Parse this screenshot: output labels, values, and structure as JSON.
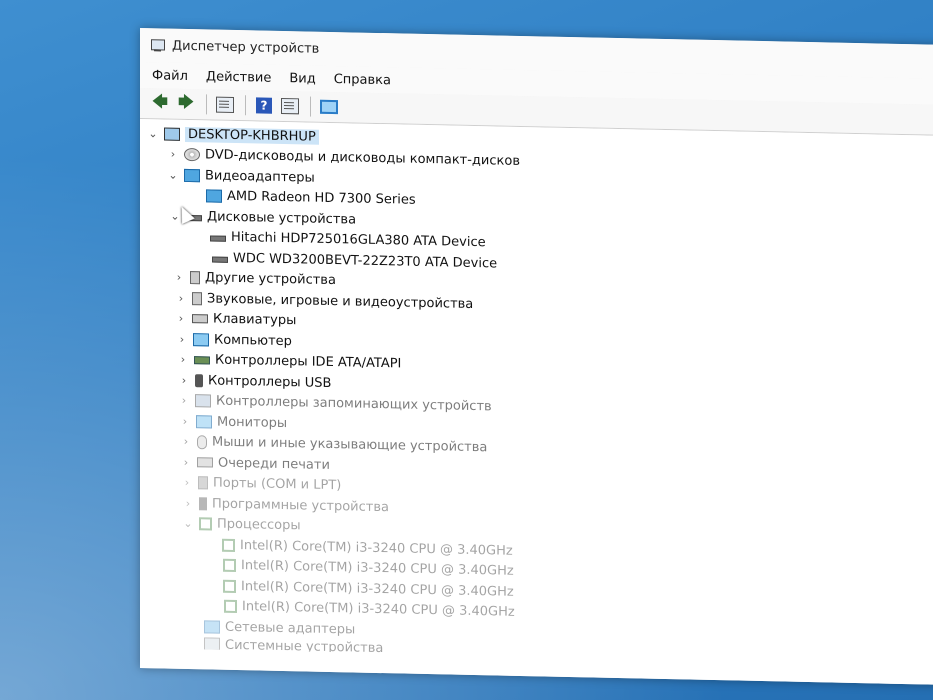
{
  "window": {
    "title": "Диспетчер устройств",
    "controls": {
      "minimize": "—"
    }
  },
  "menubar": [
    "Файл",
    "Действие",
    "Вид",
    "Справка"
  ],
  "toolbar": {
    "back": "🡄",
    "forward": "🡆",
    "help": "?"
  },
  "tree": {
    "root": "DESKTOP-KHBRHUP",
    "items": [
      {
        "label": "DVD-дисководы и дисководы компакт-дисков",
        "expanded": false
      },
      {
        "label": "Видеоадаптеры",
        "expanded": true
      },
      {
        "label": "AMD Radeon HD 7300 Series",
        "child": true
      },
      {
        "label": "Дисковые устройства",
        "expanded": true
      },
      {
        "label": "Hitachi HDP725016GLA380 ATA Device",
        "child": true
      },
      {
        "label": "WDC WD3200BEVT-22Z23T0 ATA Device",
        "child": true
      },
      {
        "label": "Другие устройства",
        "expanded": false
      },
      {
        "label": "Звуковые, игровые и видеоустройства",
        "expanded": false
      },
      {
        "label": "Клавиатуры",
        "expanded": false
      },
      {
        "label": "Компьютер",
        "expanded": false
      },
      {
        "label": "Контроллеры IDE ATA/ATAPI",
        "expanded": false
      },
      {
        "label": "Контроллеры USB",
        "expanded": false
      },
      {
        "label": "Контроллеры запоминающих устройств",
        "expanded": false
      },
      {
        "label": "Мониторы",
        "expanded": false
      },
      {
        "label": "Мыши и иные указывающие устройства",
        "expanded": false
      },
      {
        "label": "Очереди печати",
        "expanded": false
      },
      {
        "label": "Порты (COM и LPT)",
        "expanded": false
      },
      {
        "label": "Программные устройства",
        "expanded": false
      },
      {
        "label": "Процессоры",
        "expanded": true
      },
      {
        "label": "Intel(R) Core(TM) i3-3240 CPU @ 3.40GHz",
        "child": true
      },
      {
        "label": "Intel(R) Core(TM) i3-3240 CPU @ 3.40GHz",
        "child": true
      },
      {
        "label": "Intel(R) Core(TM) i3-3240 CPU @ 3.40GHz",
        "child": true
      },
      {
        "label": "Intel(R) Core(TM) i3-3240 CPU @ 3.40GHz",
        "child": true
      },
      {
        "label": "Сетевые адаптеры",
        "expanded": false
      },
      {
        "label": "Системные устройства",
        "expanded": false
      }
    ]
  },
  "chevrons": {
    "collapsed": "›",
    "expanded": "⌄"
  }
}
